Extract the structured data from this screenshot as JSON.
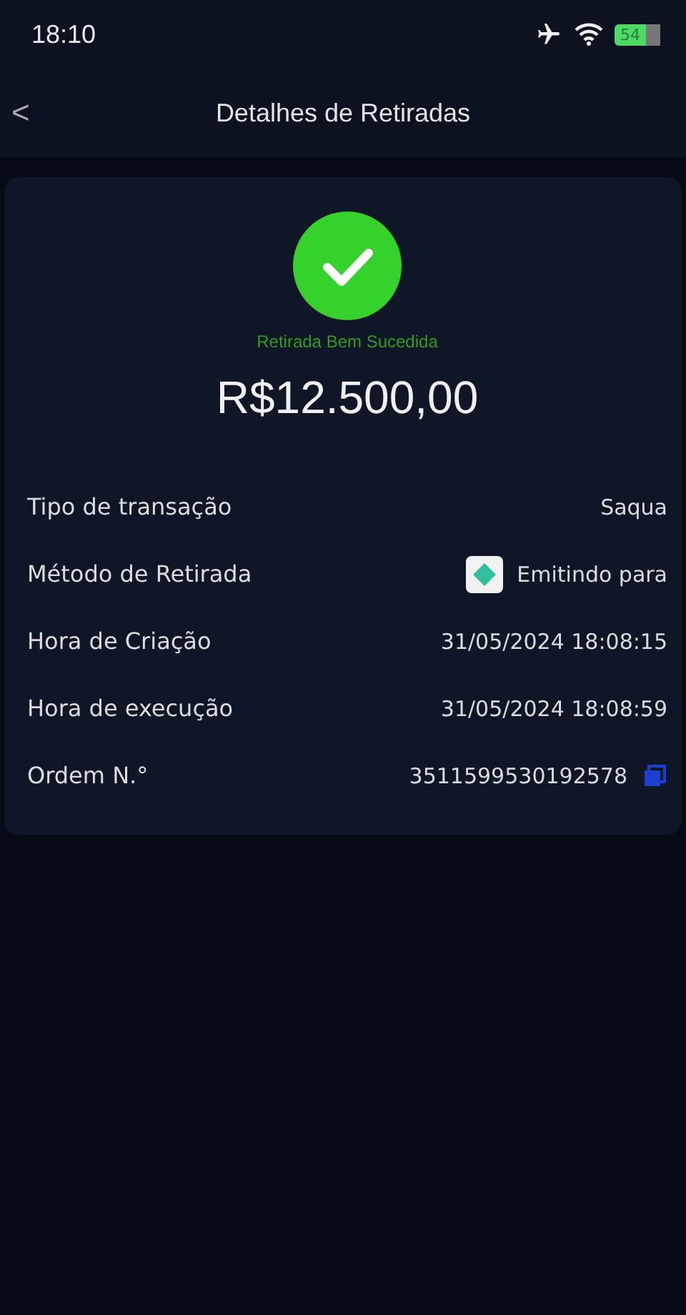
{
  "status_bar": {
    "time": "18:10",
    "battery": "54"
  },
  "header": {
    "back": "<",
    "title": "Detalhes de Retiradas"
  },
  "result": {
    "status": "Retirada Bem Sucedida",
    "amount": "R$12.500,00"
  },
  "details": [
    {
      "kind": "plain",
      "label": "Tipo de transação",
      "value": "Saqua"
    },
    {
      "kind": "method",
      "label": "Método de Retirada",
      "value": "Emitindo para"
    },
    {
      "kind": "plain",
      "label": "Hora de Criação",
      "value": "31/05/2024 18:08:15"
    },
    {
      "kind": "plain",
      "label": "Hora de execução",
      "value": "31/05/2024 18:08:59"
    },
    {
      "kind": "order",
      "label": "Ordem N.°",
      "value": "3511599530192578"
    }
  ]
}
